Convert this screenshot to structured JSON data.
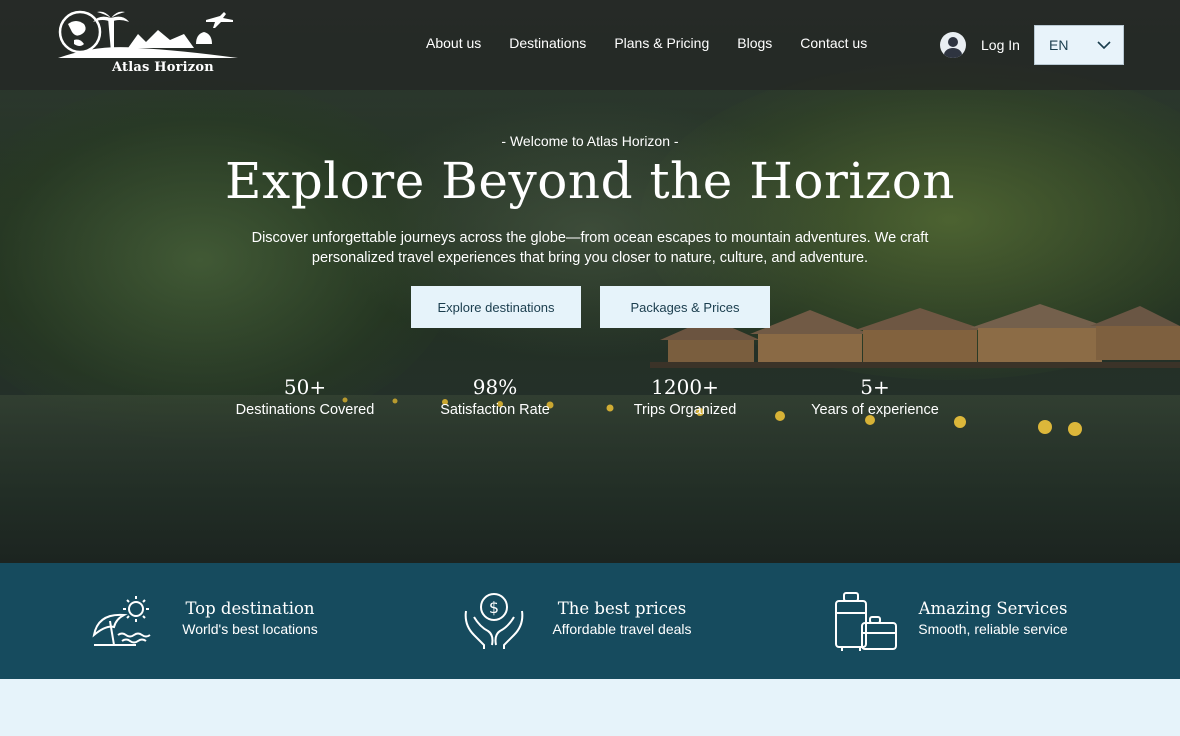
{
  "brand": {
    "name": "Atlas Horizon"
  },
  "nav": {
    "items": [
      {
        "label": "About us"
      },
      {
        "label": "Destinations"
      },
      {
        "label": "Plans & Pricing"
      },
      {
        "label": "Blogs"
      },
      {
        "label": "Contact us"
      }
    ]
  },
  "account": {
    "login_label": "Log In"
  },
  "language": {
    "selected": "EN"
  },
  "hero": {
    "eyebrow": "- Welcome to Atlas Horizon -",
    "title": "Explore Beyond the Horizon",
    "subtitle": "Discover unforgettable journeys across the globe—from ocean escapes to mountain adventures. We craft personalized travel experiences that bring you closer to nature, culture, and adventure.",
    "buttons": [
      {
        "label": "Explore destinations"
      },
      {
        "label": "Packages & Prices"
      }
    ],
    "stats": [
      {
        "value": "50+",
        "label": "Destinations Covered"
      },
      {
        "value": "98%",
        "label": "Satisfaction Rate"
      },
      {
        "value": "1200+",
        "label": "Trips Organized"
      },
      {
        "value": "5+",
        "label": "Years of experience"
      }
    ]
  },
  "features": [
    {
      "icon": "beach-umbrella-sun-icon",
      "title": "Top destination",
      "subtitle": "World's best locations"
    },
    {
      "icon": "hands-dollar-coin-icon",
      "title": "The best prices",
      "subtitle": "Affordable travel deals"
    },
    {
      "icon": "luggage-icon",
      "title": "Amazing Services",
      "subtitle": "Smooth, reliable service"
    }
  ],
  "colors": {
    "header_bg": "#222222",
    "feature_band": "#164b5e",
    "button_bg": "#e6f3fa",
    "button_text": "#1a3d4d",
    "page_bg": "#e6f3fa"
  }
}
